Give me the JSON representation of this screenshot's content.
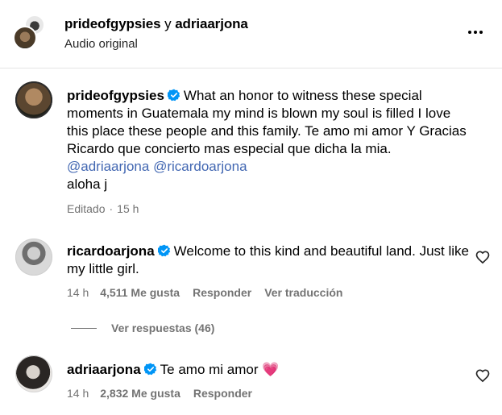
{
  "header": {
    "user_a": "prideofgypsies",
    "conjunction": "y",
    "user_b": "adriaarjona",
    "subtitle": "Audio original"
  },
  "comments": [
    {
      "username": "prideofgypsies",
      "text": "What an honor to witness these special moments in Guatemala my mind is blown my soul is filled I love this place these people and this family. Te amo mi amor Y Gracias Ricardo que concierto mas especial que dicha la mia.",
      "mentions": [
        "@adriaarjona",
        "@ricardoarjona"
      ],
      "signoff": "aloha j",
      "edited_label": "Editado",
      "separator": "·",
      "time": "15 h"
    },
    {
      "username": "ricardoarjona",
      "text": "Welcome to this kind and beautiful land. Just like my little girl.",
      "time": "14 h",
      "likes": "4,511 Me gusta",
      "reply_label": "Responder",
      "translate_label": "Ver traducción"
    },
    {
      "username": "adriaarjona",
      "text": "Te amo mi amor",
      "emoji": "💗",
      "time": "14 h",
      "likes": "2,832 Me gusta",
      "reply_label": "Responder"
    }
  ],
  "view_replies": "Ver respuestas (46)",
  "colors": {
    "verified": "#0095f6",
    "mention": "#385898",
    "meta": "#737373",
    "divider": "#e4e4e4"
  },
  "icons": [
    "more-icon",
    "verified-icon",
    "heart-outline-icon",
    "pink-heart-emoji"
  ]
}
